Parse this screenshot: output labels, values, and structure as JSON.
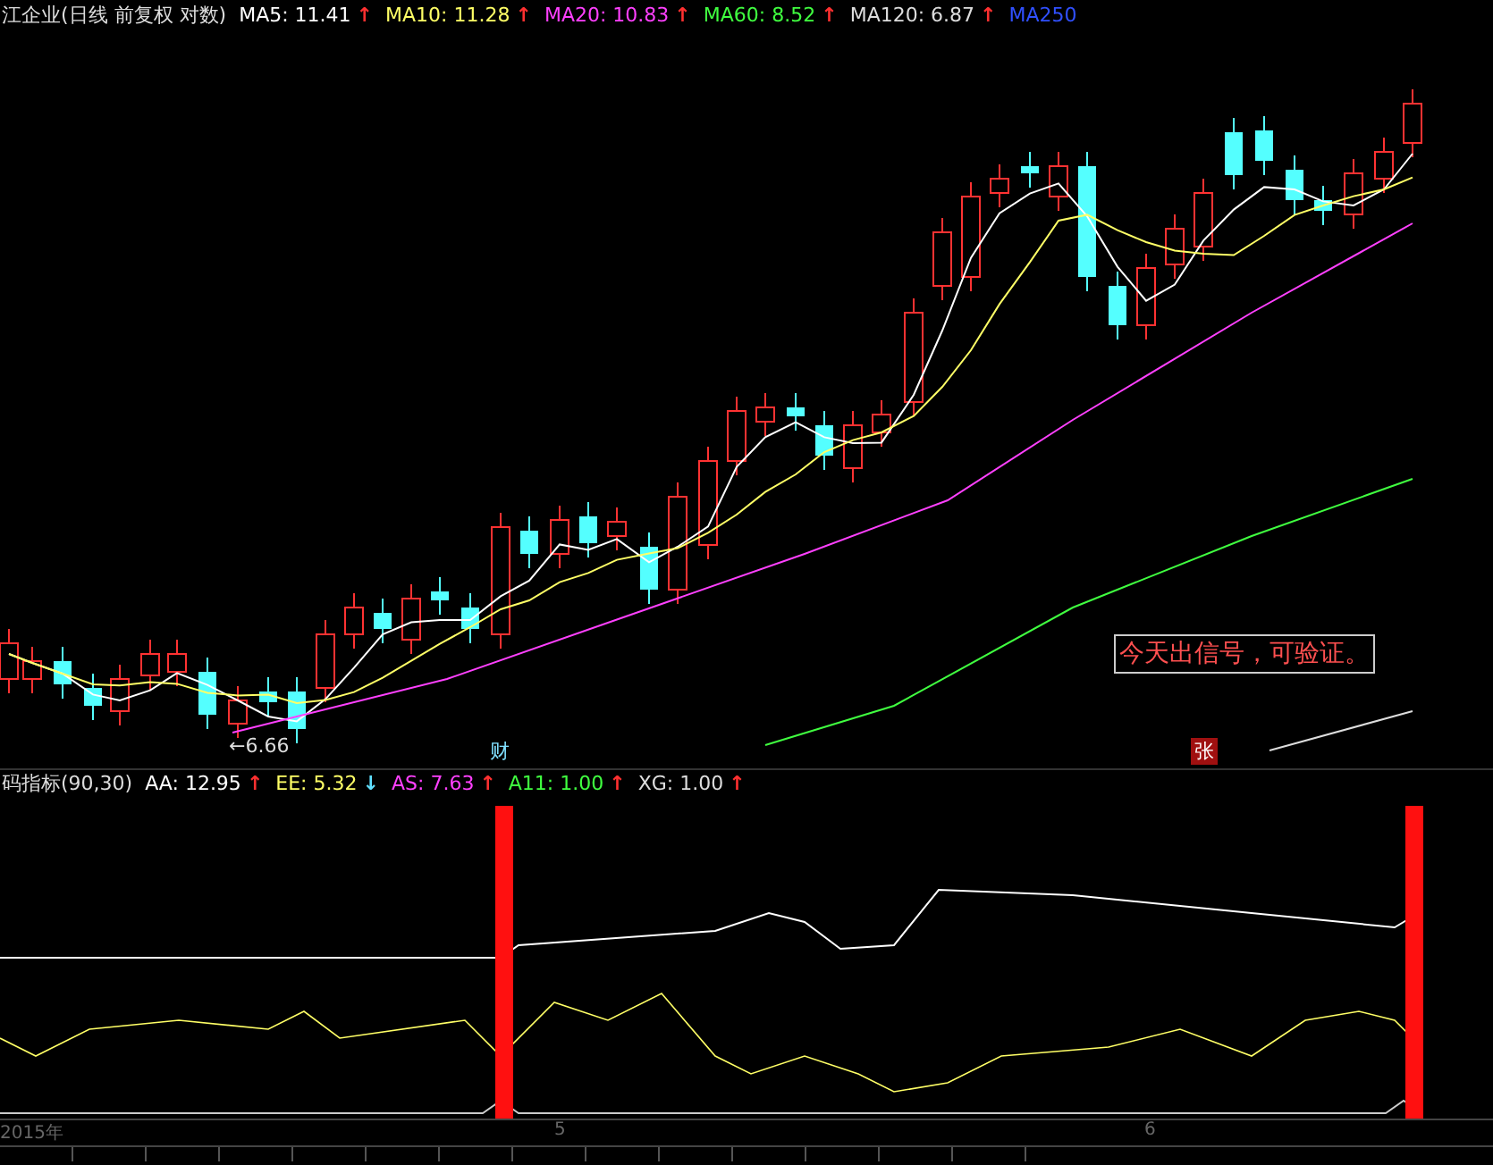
{
  "header": {
    "title": "江企业(日线 前复权 对数)",
    "indicators": [
      {
        "label": "MA5:",
        "value": "11.41",
        "arrow": "↑",
        "rising": true,
        "color": "#ffffff"
      },
      {
        "label": "MA10:",
        "value": "11.28",
        "arrow": "↑",
        "rising": true,
        "color": "#ffff66"
      },
      {
        "label": "MA20:",
        "value": "10.83",
        "arrow": "↑",
        "rising": true,
        "color": "#ff40ff"
      },
      {
        "label": "MA60:",
        "value": "8.52",
        "arrow": "↑",
        "rising": true,
        "color": "#40ff40"
      },
      {
        "label": "MA120:",
        "value": "6.87",
        "arrow": "↑",
        "rising": true,
        "color": "#dddddd"
      },
      {
        "label": "MA250",
        "color": "#3050ff"
      }
    ]
  },
  "main_chart": {
    "low_marker": "←6.66",
    "signal_note": "今天出信号，可验证。",
    "events": [
      {
        "text": "财",
        "kind": "finance"
      },
      {
        "text": "张",
        "kind": "limit"
      }
    ]
  },
  "sub_chart": {
    "title": "码指标(90,30)",
    "indicators": [
      {
        "label": "AA:",
        "value": "12.95",
        "arrow": "↑",
        "rising": true,
        "color": "#ffffff"
      },
      {
        "label": "EE:",
        "value": "5.32",
        "arrow": "↓",
        "rising": false,
        "color": "#ffff66"
      },
      {
        "label": "AS:",
        "value": "7.63",
        "arrow": "↑",
        "rising": true,
        "color": "#ff40ff"
      },
      {
        "label": "A11:",
        "value": "1.00",
        "arrow": "↑",
        "rising": true,
        "color": "#40ff40"
      },
      {
        "label": "XG:",
        "value": "1.00",
        "arrow": "↑",
        "rising": true,
        "color": "#dddddd"
      }
    ]
  },
  "date_axis": [
    "2015年",
    "5",
    "6"
  ]
}
